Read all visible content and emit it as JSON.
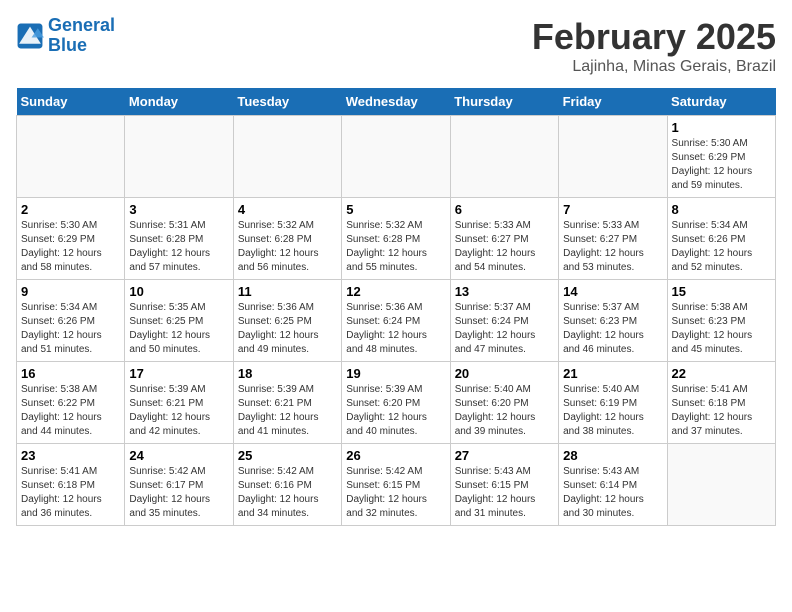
{
  "logo": {
    "line1": "General",
    "line2": "Blue"
  },
  "title": "February 2025",
  "location": "Lajinha, Minas Gerais, Brazil",
  "weekdays": [
    "Sunday",
    "Monday",
    "Tuesday",
    "Wednesday",
    "Thursday",
    "Friday",
    "Saturday"
  ],
  "weeks": [
    [
      {
        "day": "",
        "info": ""
      },
      {
        "day": "",
        "info": ""
      },
      {
        "day": "",
        "info": ""
      },
      {
        "day": "",
        "info": ""
      },
      {
        "day": "",
        "info": ""
      },
      {
        "day": "",
        "info": ""
      },
      {
        "day": "1",
        "info": "Sunrise: 5:30 AM\nSunset: 6:29 PM\nDaylight: 12 hours and 59 minutes."
      }
    ],
    [
      {
        "day": "2",
        "info": "Sunrise: 5:30 AM\nSunset: 6:29 PM\nDaylight: 12 hours and 58 minutes."
      },
      {
        "day": "3",
        "info": "Sunrise: 5:31 AM\nSunset: 6:28 PM\nDaylight: 12 hours and 57 minutes."
      },
      {
        "day": "4",
        "info": "Sunrise: 5:32 AM\nSunset: 6:28 PM\nDaylight: 12 hours and 56 minutes."
      },
      {
        "day": "5",
        "info": "Sunrise: 5:32 AM\nSunset: 6:28 PM\nDaylight: 12 hours and 55 minutes."
      },
      {
        "day": "6",
        "info": "Sunrise: 5:33 AM\nSunset: 6:27 PM\nDaylight: 12 hours and 54 minutes."
      },
      {
        "day": "7",
        "info": "Sunrise: 5:33 AM\nSunset: 6:27 PM\nDaylight: 12 hours and 53 minutes."
      },
      {
        "day": "8",
        "info": "Sunrise: 5:34 AM\nSunset: 6:26 PM\nDaylight: 12 hours and 52 minutes."
      }
    ],
    [
      {
        "day": "9",
        "info": "Sunrise: 5:34 AM\nSunset: 6:26 PM\nDaylight: 12 hours and 51 minutes."
      },
      {
        "day": "10",
        "info": "Sunrise: 5:35 AM\nSunset: 6:25 PM\nDaylight: 12 hours and 50 minutes."
      },
      {
        "day": "11",
        "info": "Sunrise: 5:36 AM\nSunset: 6:25 PM\nDaylight: 12 hours and 49 minutes."
      },
      {
        "day": "12",
        "info": "Sunrise: 5:36 AM\nSunset: 6:24 PM\nDaylight: 12 hours and 48 minutes."
      },
      {
        "day": "13",
        "info": "Sunrise: 5:37 AM\nSunset: 6:24 PM\nDaylight: 12 hours and 47 minutes."
      },
      {
        "day": "14",
        "info": "Sunrise: 5:37 AM\nSunset: 6:23 PM\nDaylight: 12 hours and 46 minutes."
      },
      {
        "day": "15",
        "info": "Sunrise: 5:38 AM\nSunset: 6:23 PM\nDaylight: 12 hours and 45 minutes."
      }
    ],
    [
      {
        "day": "16",
        "info": "Sunrise: 5:38 AM\nSunset: 6:22 PM\nDaylight: 12 hours and 44 minutes."
      },
      {
        "day": "17",
        "info": "Sunrise: 5:39 AM\nSunset: 6:21 PM\nDaylight: 12 hours and 42 minutes."
      },
      {
        "day": "18",
        "info": "Sunrise: 5:39 AM\nSunset: 6:21 PM\nDaylight: 12 hours and 41 minutes."
      },
      {
        "day": "19",
        "info": "Sunrise: 5:39 AM\nSunset: 6:20 PM\nDaylight: 12 hours and 40 minutes."
      },
      {
        "day": "20",
        "info": "Sunrise: 5:40 AM\nSunset: 6:20 PM\nDaylight: 12 hours and 39 minutes."
      },
      {
        "day": "21",
        "info": "Sunrise: 5:40 AM\nSunset: 6:19 PM\nDaylight: 12 hours and 38 minutes."
      },
      {
        "day": "22",
        "info": "Sunrise: 5:41 AM\nSunset: 6:18 PM\nDaylight: 12 hours and 37 minutes."
      }
    ],
    [
      {
        "day": "23",
        "info": "Sunrise: 5:41 AM\nSunset: 6:18 PM\nDaylight: 12 hours and 36 minutes."
      },
      {
        "day": "24",
        "info": "Sunrise: 5:42 AM\nSunset: 6:17 PM\nDaylight: 12 hours and 35 minutes."
      },
      {
        "day": "25",
        "info": "Sunrise: 5:42 AM\nSunset: 6:16 PM\nDaylight: 12 hours and 34 minutes."
      },
      {
        "day": "26",
        "info": "Sunrise: 5:42 AM\nSunset: 6:15 PM\nDaylight: 12 hours and 32 minutes."
      },
      {
        "day": "27",
        "info": "Sunrise: 5:43 AM\nSunset: 6:15 PM\nDaylight: 12 hours and 31 minutes."
      },
      {
        "day": "28",
        "info": "Sunrise: 5:43 AM\nSunset: 6:14 PM\nDaylight: 12 hours and 30 minutes."
      },
      {
        "day": "",
        "info": ""
      }
    ]
  ]
}
